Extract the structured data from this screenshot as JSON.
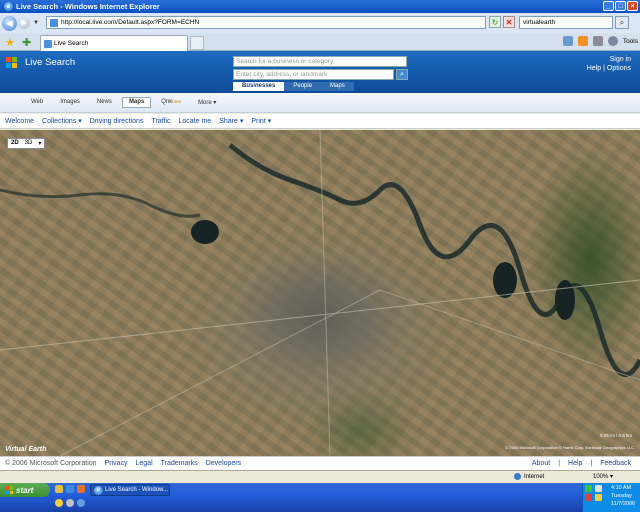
{
  "window": {
    "title": "Live Search - Windows Internet Explorer"
  },
  "browser": {
    "address": "http://local.live.com/Default.aspx?FORM=ECHN",
    "search_value": "virtualearth",
    "tab_title": "Live Search",
    "tools_label": "Tools"
  },
  "header": {
    "title": "Live Search",
    "business_placeholder": "Search for a business or category",
    "location_placeholder": "Enter city, address, or landmark",
    "search_tabs": [
      "Businesses",
      "People",
      "Maps"
    ],
    "sign_in": "Sign in",
    "help": "Help",
    "options": "Options"
  },
  "vertical_nav": {
    "items": [
      "Web",
      "Images",
      "News",
      "Maps",
      "Qnk",
      "More"
    ],
    "beta": "beta"
  },
  "map_toolbar": {
    "items": [
      "Welcome",
      "Collections",
      "Driving directions",
      "Traffic",
      "Locate me",
      "Share",
      "Print"
    ]
  },
  "map": {
    "mode_2d": "2D",
    "mode_3d": "3D",
    "logo": "Virtual Earth",
    "copyright": "© 2006 Microsoft Corporation   © Harris Corp, Earthstar Geographics LLC",
    "scale": "0.25 mi / 0.5 km"
  },
  "footer": {
    "copyright": "© 2006 Microsoft Corporation",
    "links_left": [
      "Privacy",
      "Legal",
      "Trademarks",
      "Developers"
    ],
    "links_right": [
      "About",
      "Help",
      "Feedback"
    ]
  },
  "statusbar": {
    "zone": "Internet",
    "zoom": "100%"
  },
  "taskbar": {
    "start": "start",
    "task": "Live Search - Window...",
    "time": "4:10 AM",
    "day": "Tuesday",
    "date": "11/7/2006"
  }
}
